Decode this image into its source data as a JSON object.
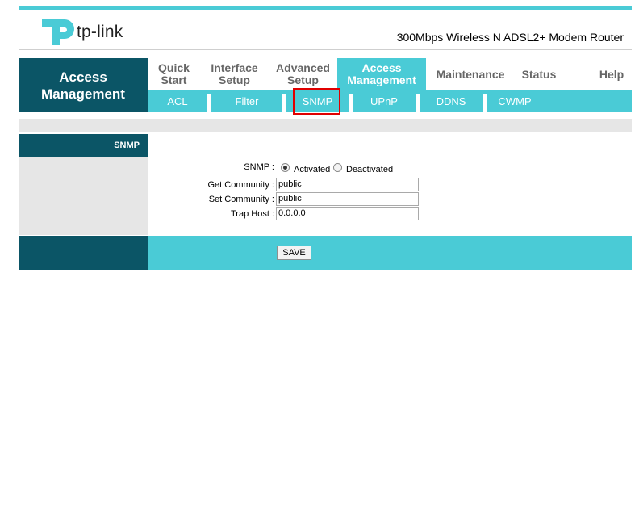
{
  "header": {
    "brand": "tp-link",
    "product": "300Mbps Wireless N ADSL2+ Modem Router"
  },
  "section": {
    "title_line1": "Access",
    "title_line2": "Management"
  },
  "menu": [
    {
      "line1": "Quick",
      "line2": "Start"
    },
    {
      "line1": "Interface",
      "line2": "Setup"
    },
    {
      "line1": "Advanced",
      "line2": "Setup"
    },
    {
      "line1": "Access",
      "line2": "Management",
      "active": true
    },
    {
      "line1": "Maintenance",
      "line2": ""
    },
    {
      "line1": "Status",
      "line2": ""
    },
    {
      "line1": "Help",
      "line2": ""
    }
  ],
  "submenu": [
    "ACL",
    "Filter",
    "SNMP",
    "UPnP",
    "DDNS",
    "CWMP"
  ],
  "form": {
    "section_label": "SNMP",
    "snmp_label": "SNMP :",
    "activated_label": "Activated",
    "deactivated_label": "Deactivated",
    "snmp_state": "Activated",
    "get_community_label": "Get Community :",
    "get_community_value": "public",
    "set_community_label": "Set Community :",
    "set_community_value": "public",
    "trap_host_label": "Trap Host :",
    "trap_host_value": "0.0.0.0",
    "save_label": "SAVE"
  },
  "colors": {
    "teal": "#4acbd6",
    "dark_teal": "#0b5566",
    "highlight": "#e00000"
  }
}
